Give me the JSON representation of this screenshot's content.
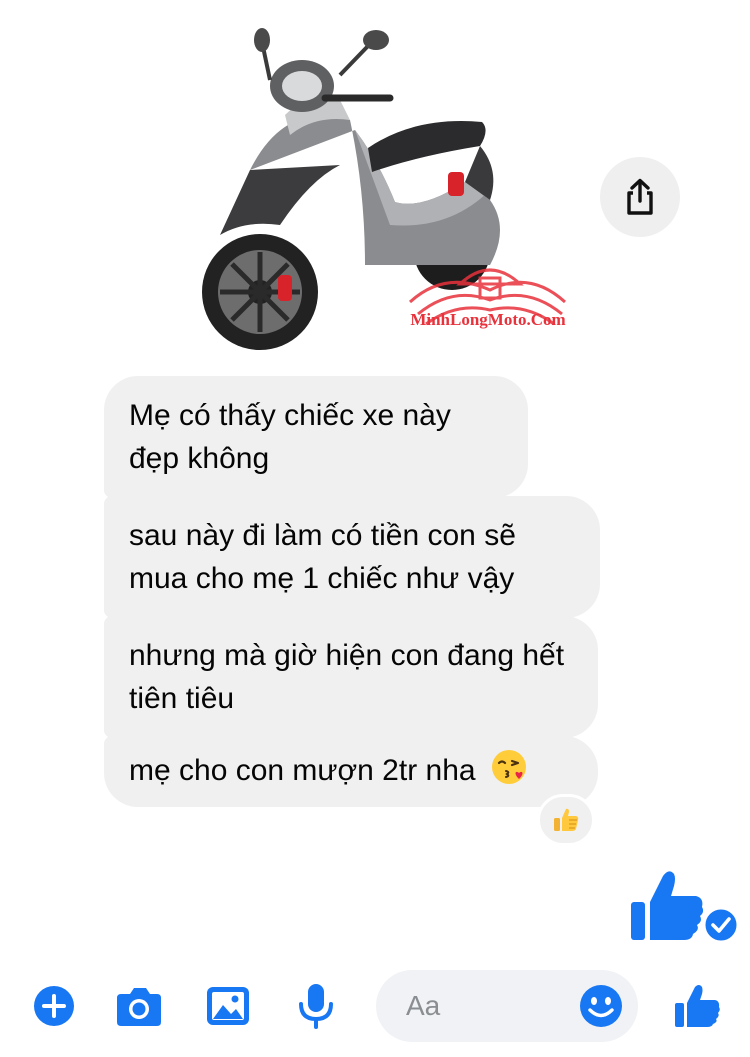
{
  "photo": {
    "watermark": "MinhLongMoto.Com"
  },
  "messages": [
    {
      "text": "Mẹ có thấy chiếc xe này đẹp không"
    },
    {
      "text": "sau này đi làm có tiền con sẽ mua cho mẹ 1 chiếc như vậy"
    },
    {
      "text": "nhưng mà giờ hiện con đang hết tiên tiêu"
    },
    {
      "text": "mẹ cho con mượn 2tr nha"
    }
  ],
  "composer": {
    "placeholder": "Aa"
  },
  "colors": {
    "accent": "#1877f2",
    "bubble": "#f0f0f0",
    "watermark": "#e8323c"
  },
  "icons": [
    "share-icon",
    "kissing-emoji-icon",
    "thumbs-up-reaction-icon",
    "thumbs-up-icon",
    "seen-check-icon",
    "plus-icon",
    "camera-icon",
    "image-icon",
    "microphone-icon",
    "smiley-icon",
    "like-icon"
  ]
}
